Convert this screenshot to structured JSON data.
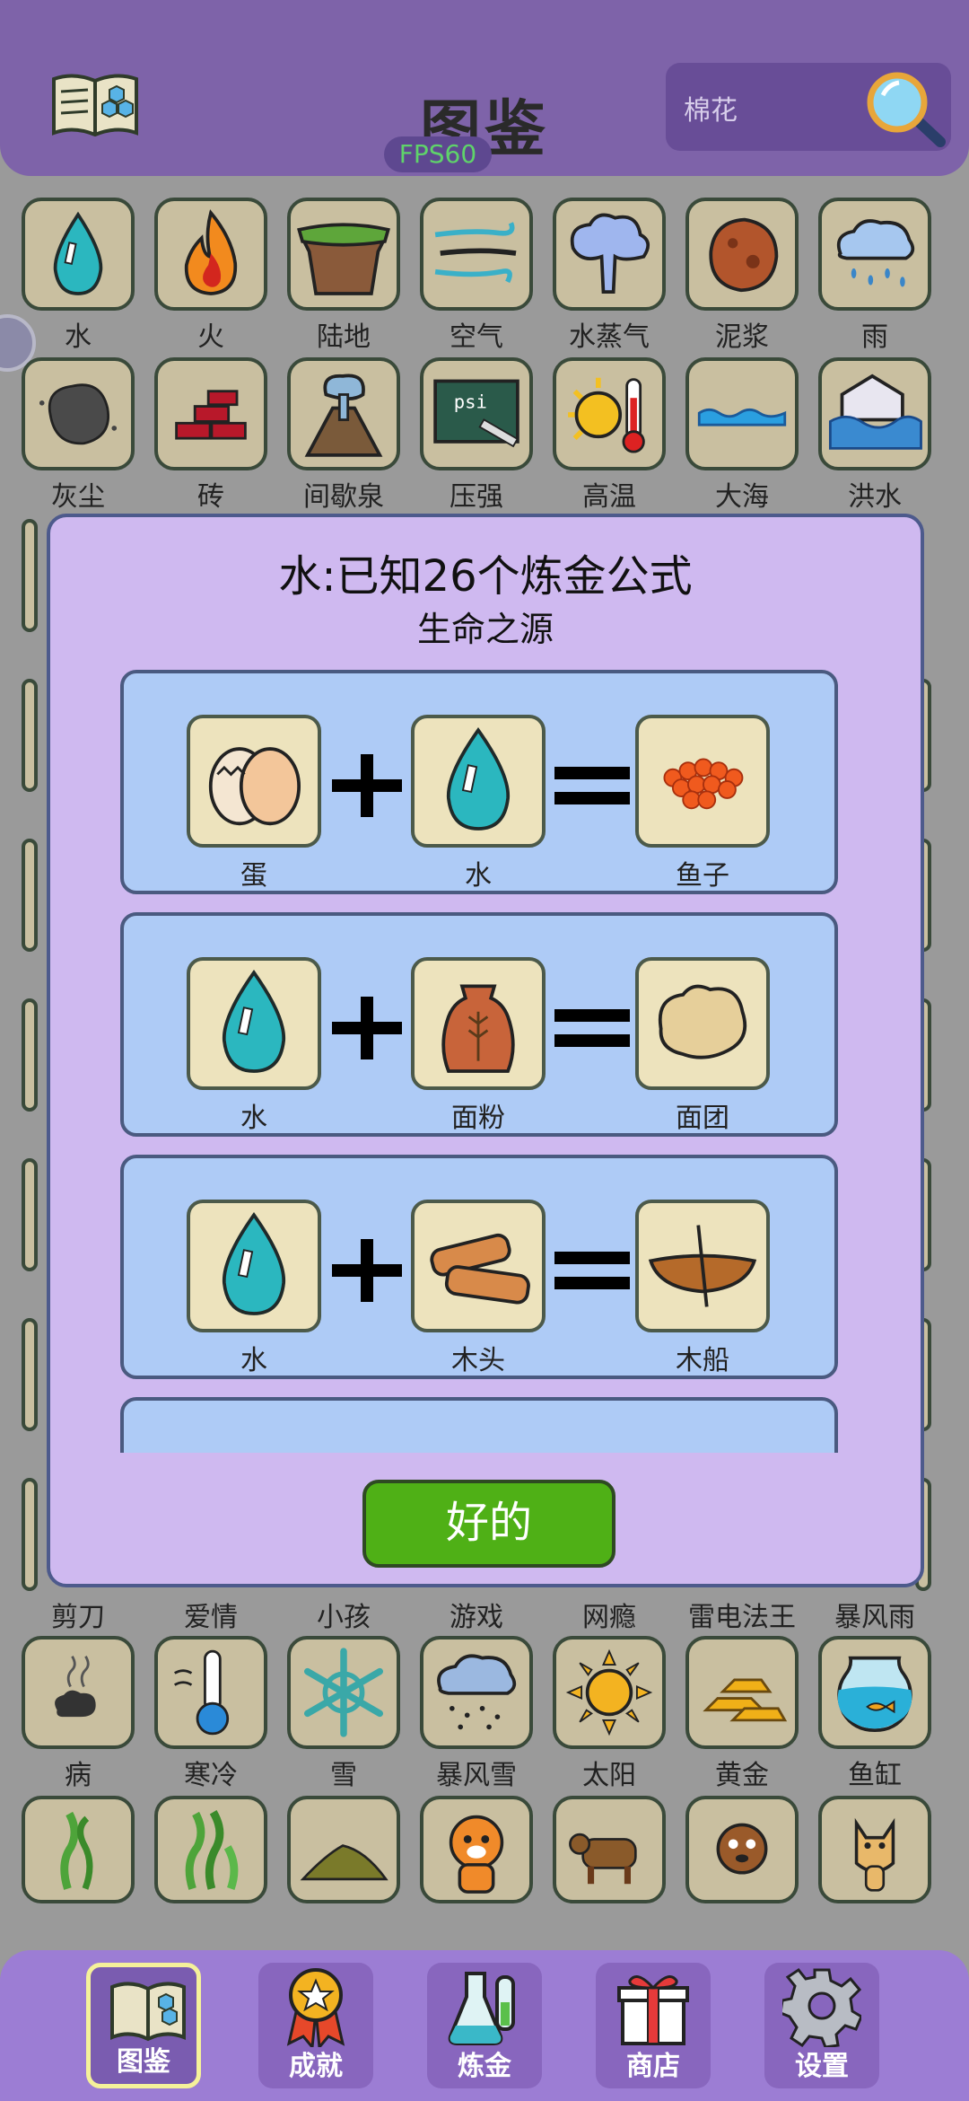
{
  "header": {
    "title": "图鉴",
    "fps": "FPS60",
    "search_value": "棉花",
    "book_icon": "book-hex-icon",
    "search_icon": "magnifier-icon"
  },
  "grid": {
    "rows": [
      [
        "水",
        "火",
        "陆地",
        "空气",
        "水蒸气",
        "泥浆",
        "雨"
      ],
      [
        "灰尘",
        "砖",
        "间歇泉",
        "压强",
        "高温",
        "大海",
        "洪水"
      ],
      [
        "剪刀",
        "爱情",
        "小孩",
        "游戏",
        "网瘾",
        "雷电法王",
        "暴风雨"
      ],
      [
        "病",
        "寒冷",
        "雪",
        "暴风雪",
        "太阳",
        "黄金",
        "鱼缸"
      ]
    ]
  },
  "modal": {
    "title": "水:已知26个炼金公式",
    "subtitle": "生命之源",
    "recipes": [
      {
        "a": "蛋",
        "b": "水",
        "result": "鱼子"
      },
      {
        "a": "水",
        "b": "面粉",
        "result": "面团"
      },
      {
        "a": "水",
        "b": "木头",
        "result": "木船"
      }
    ],
    "ok_label": "好的"
  },
  "nav": {
    "items": [
      {
        "label": "图鉴",
        "icon": "book-icon",
        "active": true
      },
      {
        "label": "成就",
        "icon": "medal-icon",
        "active": false
      },
      {
        "label": "炼金",
        "icon": "flask-icon",
        "active": false
      },
      {
        "label": "商店",
        "icon": "gift-icon",
        "active": false
      },
      {
        "label": "设置",
        "icon": "gear-icon",
        "active": false
      }
    ]
  },
  "colors": {
    "header_bg": "#7e63a9",
    "modal_bg": "#cfb9f0",
    "recipe_bg": "#aecbf6",
    "ok_button": "#4fb016",
    "nav_bg": "#9c7dd4",
    "fps_text": "#5fd36a"
  }
}
